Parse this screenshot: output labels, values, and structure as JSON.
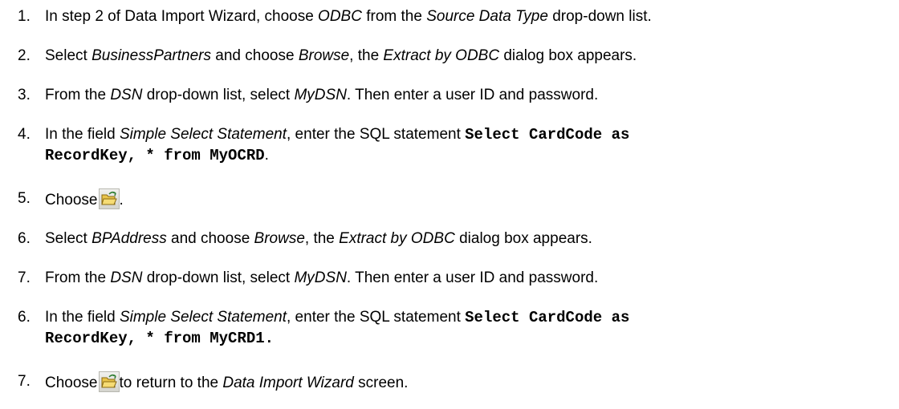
{
  "steps": [
    {
      "number": "1.",
      "parts": [
        {
          "t": "In step 2 of Data Import Wizard, choose "
        },
        {
          "t": "ODBC",
          "i": true
        },
        {
          "t": " from the "
        },
        {
          "t": "Source Data Type",
          "i": true
        },
        {
          "t": " drop-down list."
        }
      ]
    },
    {
      "number": "2.",
      "parts": [
        {
          "t": "Select "
        },
        {
          "t": "BusinessPartners",
          "i": true
        },
        {
          "t": " and choose "
        },
        {
          "t": "Browse",
          "i": true
        },
        {
          "t": ", the "
        },
        {
          "t": "Extract by ODBC",
          "i": true
        },
        {
          "t": " dialog box appears."
        }
      ]
    },
    {
      "number": "3.",
      "parts": [
        {
          "t": "From the "
        },
        {
          "t": "DSN",
          "i": true
        },
        {
          "t": " drop-down list, select "
        },
        {
          "t": "MyDSN",
          "i": true
        },
        {
          "t": ". Then enter a user ID and password."
        }
      ]
    },
    {
      "number": "4.",
      "parts": [
        {
          "t": "In the field "
        },
        {
          "t": "Simple Select Statement",
          "i": true
        },
        {
          "t": ", enter the SQL statement "
        },
        {
          "t": "Select CardCode as",
          "code": true
        },
        {
          "br": true
        },
        {
          "t": "RecordKey, * from MyOCRD",
          "code": true
        },
        {
          "t": "."
        }
      ]
    },
    {
      "number": "5.",
      "parts": [
        {
          "t": "Choose"
        },
        {
          "icon": "open-folder-icon"
        },
        {
          "t": "."
        }
      ]
    },
    {
      "number": "6.",
      "parts": [
        {
          "t": "Select "
        },
        {
          "t": "BPAddress",
          "i": true
        },
        {
          "t": " and choose "
        },
        {
          "t": "Browse",
          "i": true
        },
        {
          "t": ", the "
        },
        {
          "t": "Extract by ODBC",
          "i": true
        },
        {
          "t": " dialog box appears."
        }
      ]
    },
    {
      "number": "7.",
      "parts": [
        {
          "t": "From the "
        },
        {
          "t": "DSN",
          "i": true
        },
        {
          "t": " drop-down list, select "
        },
        {
          "t": "MyDSN",
          "i": true
        },
        {
          "t": ". Then enter a user ID and password."
        }
      ]
    },
    {
      "number": "6.",
      "parts": [
        {
          "t": "In the field "
        },
        {
          "t": "Simple Select Statement",
          "i": true
        },
        {
          "t": ", enter the SQL statement "
        },
        {
          "t": "Select CardCode as",
          "code": true
        },
        {
          "br": true
        },
        {
          "t": "RecordKey, * from MyCRD1.",
          "code": true
        }
      ]
    },
    {
      "number": "7.",
      "parts": [
        {
          "t": "Choose"
        },
        {
          "icon": "open-folder-icon"
        },
        {
          "t": "to return to the "
        },
        {
          "t": "Data Import Wizard",
          "i": true
        },
        {
          "t": " screen."
        }
      ]
    }
  ]
}
